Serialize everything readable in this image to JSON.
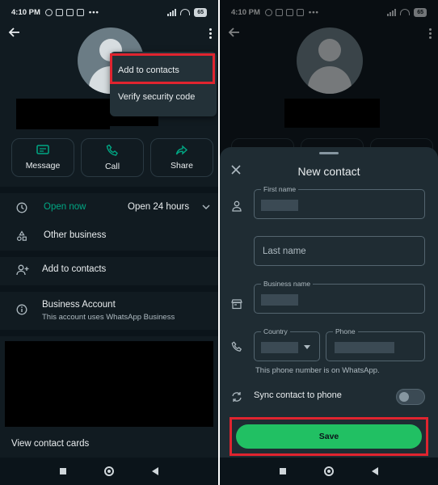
{
  "status": {
    "time": "4:10 PM",
    "battery": "65"
  },
  "left": {
    "menu": {
      "add_to_contacts": "Add to contacts",
      "verify_security_code": "Verify security code"
    },
    "actions": [
      {
        "label": "Message",
        "icon": "message-icon"
      },
      {
        "label": "Call",
        "icon": "phone-icon"
      },
      {
        "label": "Share",
        "icon": "share-icon"
      }
    ],
    "hours": {
      "status": "Open now",
      "value": "Open 24 hours"
    },
    "category": "Other business",
    "add_to_contacts": "Add to contacts",
    "business_account": {
      "title": "Business Account",
      "subtitle": "This account uses WhatsApp Business"
    },
    "view_contact_cards": "View contact cards"
  },
  "right": {
    "sheet_title": "New contact",
    "fields": {
      "first_name_label": "First name",
      "last_name_placeholder": "Last name",
      "business_name_label": "Business name",
      "country_label": "Country",
      "phone_label": "Phone"
    },
    "helper": "This phone number is on WhatsApp.",
    "sync_label": "Sync contact to phone",
    "sync_enabled": false,
    "save_label": "Save"
  },
  "colors": {
    "background": "#111b21",
    "accent": "#00a884",
    "save_button": "#21c063",
    "highlight": "#e0242f"
  }
}
